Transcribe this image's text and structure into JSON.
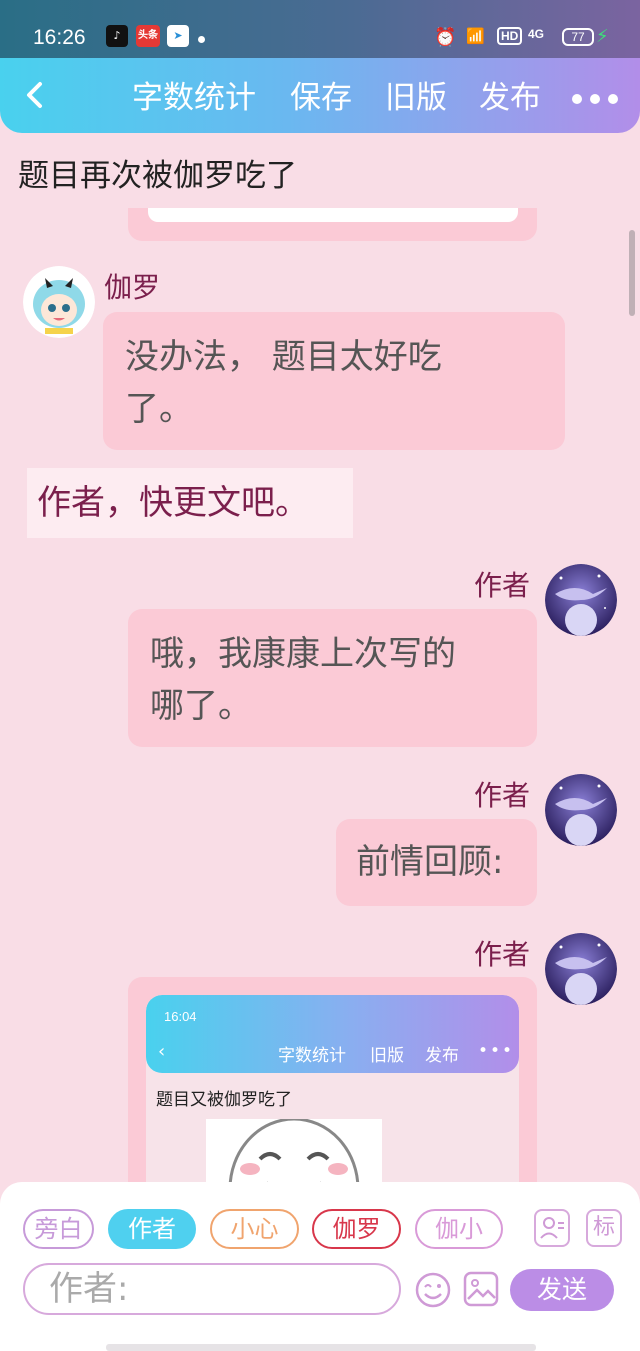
{
  "status_bar": {
    "time": "16:26",
    "app_icons": [
      "tiktok-icon",
      "toutiao-icon",
      "telegram-icon"
    ],
    "toutiao_label": "头条",
    "hd_label": "HD",
    "network_label": "4G",
    "battery": "77"
  },
  "toolbar": {
    "word_count": "字数统计",
    "save": "保存",
    "old_version": "旧版",
    "publish": "发布"
  },
  "story_title": "题目再次被伽罗吃了",
  "messages": [
    {
      "speaker": "伽罗",
      "text": "没办法， 题目太好吃了。",
      "line1": "没办法， 题目太好吃",
      "line2": "了。"
    },
    {
      "aside": "作者，快更文吧。"
    },
    {
      "speaker": "作者",
      "line1": "哦，我康康上次写的",
      "line2": "哪了。"
    },
    {
      "speaker": "作者",
      "text": "前情回顾:"
    },
    {
      "speaker": "作者",
      "image": "screenshot"
    }
  ],
  "embedded_screenshot": {
    "time": "16:04",
    "word_count": "字数统计",
    "old_version": "旧版",
    "publish": "发布",
    "title": "题目又被伽罗吃了"
  },
  "role_chips": [
    {
      "label": "旁白",
      "color": "#c79ad9"
    },
    {
      "label": "作者",
      "color": "#4fd0ef",
      "selected": true
    },
    {
      "label": "小心",
      "color": "#f0a46e"
    },
    {
      "label": "伽罗",
      "color": "#d8374b"
    },
    {
      "label": "伽小",
      "color": "#d99ad8"
    }
  ],
  "tag_label": "标",
  "input": {
    "placeholder": "作者:"
  },
  "send_label": "发送",
  "colors": {
    "accent": "#4fd0ef",
    "name": "#7b1f4c",
    "bubble": "#fbcad6",
    "send": "#bb8de6"
  }
}
